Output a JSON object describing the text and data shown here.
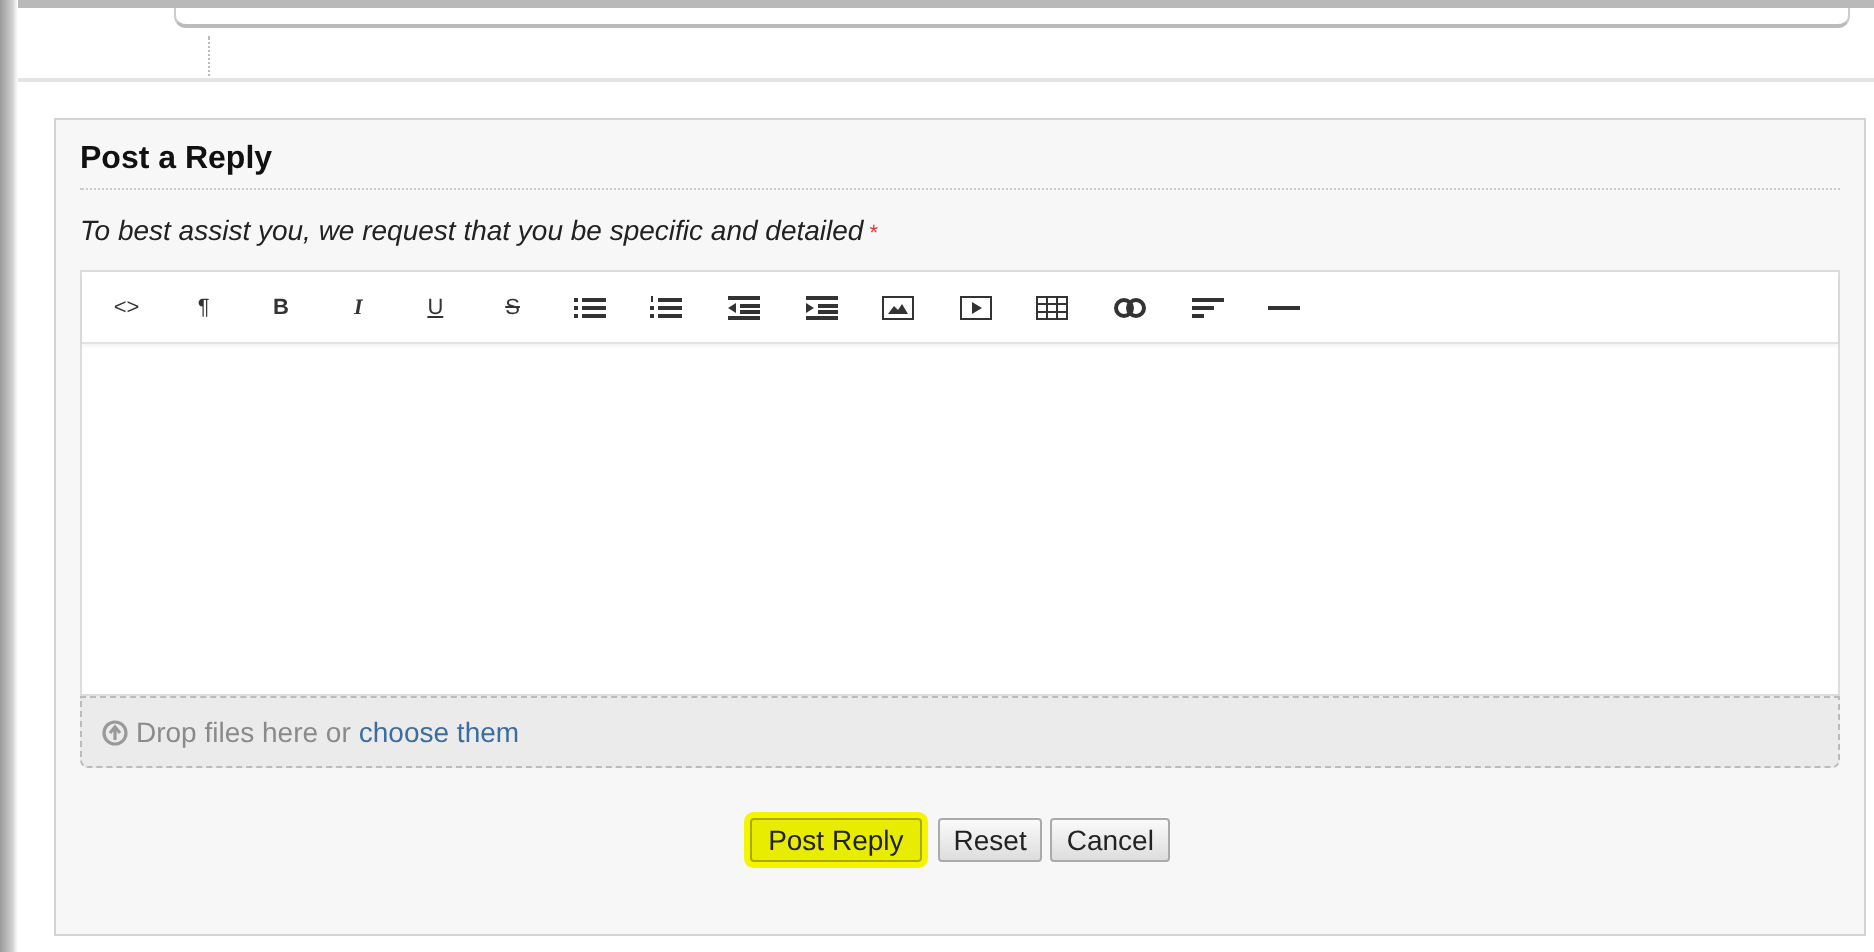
{
  "reply_form": {
    "title": "Post a Reply",
    "instruction": "To best assist you, we request that you be specific and detailed",
    "required_mark": "*",
    "toolbar": [
      {
        "kind": "glyph",
        "label": "<>"
      },
      {
        "kind": "glyph",
        "label": "¶"
      },
      {
        "kind": "bold",
        "label": "B"
      },
      {
        "kind": "italic",
        "label": "I"
      },
      {
        "kind": "underline",
        "label": "U"
      },
      {
        "kind": "strike",
        "label": "S"
      },
      {
        "kind": "bullets"
      },
      {
        "kind": "numbers"
      },
      {
        "kind": "outdent"
      },
      {
        "kind": "indent"
      },
      {
        "kind": "image"
      },
      {
        "kind": "video"
      },
      {
        "kind": "table"
      },
      {
        "kind": "link"
      },
      {
        "kind": "align"
      },
      {
        "kind": "rule"
      }
    ],
    "dropzone": {
      "text": "Drop files here or",
      "link": "choose them"
    },
    "buttons": [
      {
        "label": "Post Reply",
        "highlighted": true
      },
      {
        "label": "Reset",
        "highlighted": false
      },
      {
        "label": "Cancel",
        "highlighted": false
      }
    ]
  }
}
